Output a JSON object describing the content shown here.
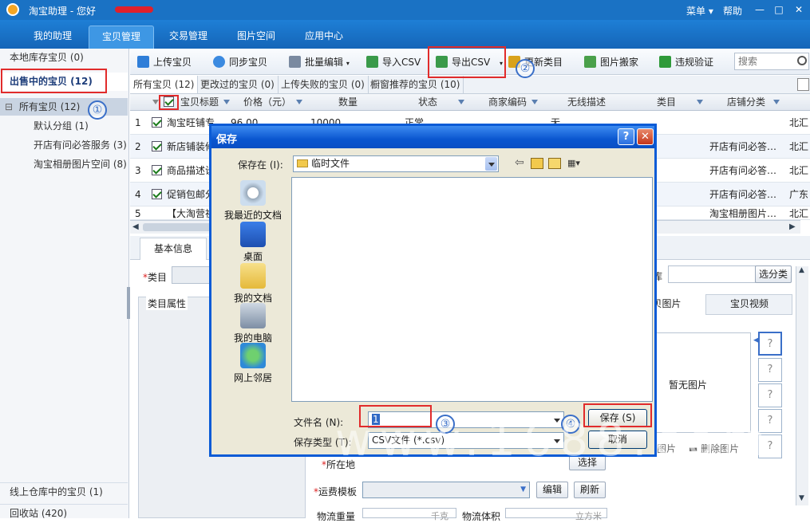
{
  "app": {
    "title": "淘宝助理 - 您好",
    "menu": "菜单",
    "help": "帮助"
  },
  "nav": {
    "tabs": [
      "我的助理",
      "宝贝管理",
      "交易管理",
      "图片空间",
      "应用中心"
    ]
  },
  "sidebar": {
    "local": "本地库存宝贝 (0)",
    "selling": "出售中的宝贝 (12)",
    "tree": [
      {
        "label": "所有宝贝 (12)",
        "toggle": "⊟"
      },
      {
        "label": "默认分组 (1)"
      },
      {
        "label": "开店有问必答服务 (3)"
      },
      {
        "label": "淘宝相册图片空间 (8)"
      }
    ],
    "warehouse": "线上仓库中的宝贝 (1)",
    "recycle": "回收站 (420)"
  },
  "toolbar": {
    "upload": "上传宝贝",
    "sync": "同步宝贝",
    "batch_edit": "批量编辑",
    "import_csv": "导入CSV",
    "export_csv": "导出CSV",
    "update_category": "更新类目",
    "image_move": "图片搬家",
    "violation_check": "违规验证",
    "search_placeholder": "搜索"
  },
  "subtabs": [
    "所有宝贝 (12)",
    "更改过的宝贝 (0)",
    "上传失败的宝贝 (0)",
    "橱窗推荐的宝贝 (10)"
  ],
  "grid": {
    "columns": [
      "宝贝标题",
      "价格（元）",
      "数量",
      "状态",
      "商家编码",
      "无线描述",
      "类目",
      "店铺分类"
    ],
    "rows": [
      {
        "n": "1",
        "title": "淘宝旺铺专…",
        "price": "96.00",
        "qty": "10000",
        "status": "正常",
        "mobile": "无",
        "shop_cat": "",
        "extra": "北汇"
      },
      {
        "n": "2",
        "title": "新店铺装修",
        "price": "",
        "qty": "",
        "status": "",
        "mobile": "",
        "shop_cat": "开店有问必答…",
        "extra": "北汇"
      },
      {
        "n": "3",
        "title": "商品描述设",
        "price": "",
        "qty": "",
        "status": "",
        "mobile": "",
        "shop_cat": "开店有问必答…",
        "extra": "北汇"
      },
      {
        "n": "4",
        "title": "促销包邮分",
        "price": "",
        "qty": "",
        "status": "",
        "mobile": "",
        "shop_cat": "开店有问必答…",
        "extra": "广东"
      },
      {
        "n": "5",
        "title": "【大淘营祝",
        "price": "",
        "qty": "",
        "status": "",
        "mobile": "",
        "shop_cat": "淘宝相册图片…",
        "extra": "北汇"
      }
    ]
  },
  "detail": {
    "tab_basic": "基本信息",
    "category_label": "类目",
    "category_props": "类目属性",
    "select_category": "选分类",
    "img_tab": "宝贝图片",
    "video_tab": "宝贝视频",
    "no_image": "暂无图片",
    "image_label": "图片",
    "delete_image": "删除图片",
    "location": "所在地",
    "choose": "选择",
    "freight": "运费模板",
    "edit": "编辑",
    "refresh": "刷新",
    "weight": "物流重量",
    "weight_unit": "千克",
    "volume": "物流体积",
    "volume_unit": "立方米",
    "qmark": "?"
  },
  "dialog": {
    "title": "保存",
    "save_in_label": "保存在 (I):",
    "folder": "临时文件",
    "places": [
      "我最近的文档",
      "桌面",
      "我的文档",
      "我的电脑",
      "网上邻居"
    ],
    "filename_label": "文件名 (N):",
    "filename_value": "1",
    "filetype_label": "保存类型 (T):",
    "filetype_value": "CSV文件 (*.csv)",
    "save_button": "保存 (S)",
    "cancel_button": "取消",
    "help": "?",
    "close": "✕"
  },
  "annotations": [
    "①",
    "②",
    "③",
    "④"
  ],
  "watermark": "www.1688.com",
  "colors": {
    "brand_blue": "#1a72c4",
    "annotation_red": "#e12b2b",
    "annotation_blue": "#3a6fc8",
    "xp_title": "#0a56d0"
  }
}
